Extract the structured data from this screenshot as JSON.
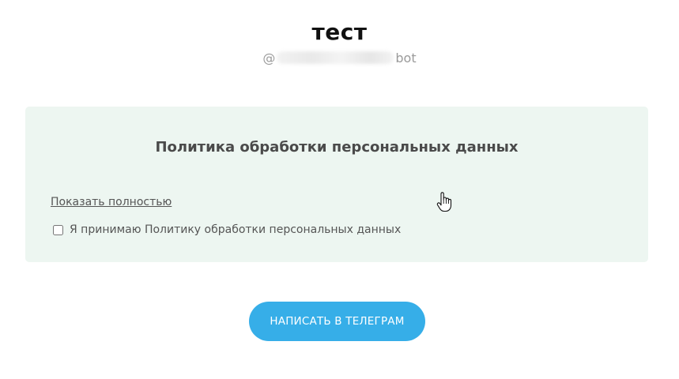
{
  "header": {
    "title": "тест",
    "handle_prefix": "@",
    "handle_suffix": "bot"
  },
  "policy": {
    "title": "Политика обработки персональных данных",
    "show_full_link": "Показать полностью",
    "consent_label": "Я принимаю Политику обработки персональных данных",
    "consent_checked": false
  },
  "action": {
    "telegram_button": "НАПИСАТЬ В ТЕЛЕГРАМ"
  },
  "colors": {
    "card_background": "#edf6f1",
    "button_background": "#36aee8",
    "button_text": "#ffffff"
  },
  "icons": {
    "cursor": "hand-pointer-icon"
  }
}
